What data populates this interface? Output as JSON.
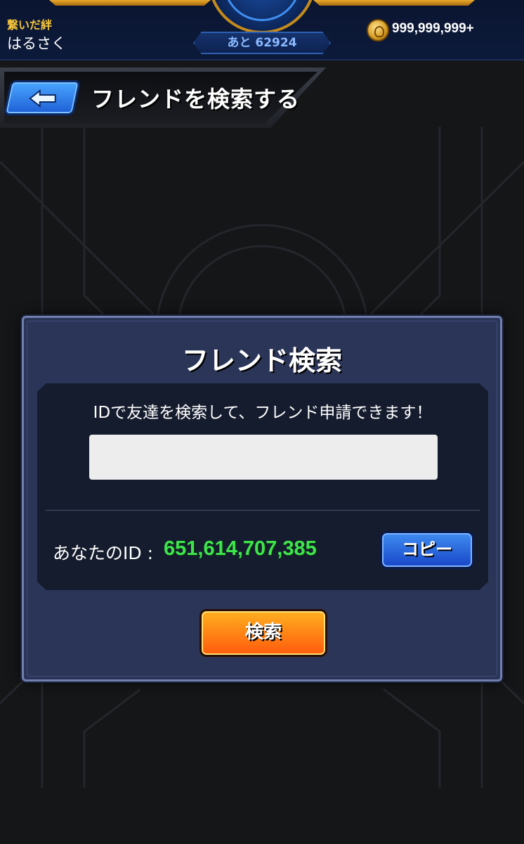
{
  "status_bar": {
    "bond_label": "繋いだ絆",
    "player_name": "はるさく",
    "remaining_prefix": "あと",
    "remaining_value": "62924",
    "coin_count": "999,999,999+"
  },
  "header": {
    "title": "フレンドを検索する"
  },
  "dialog": {
    "title": "フレンド検索",
    "instruction": "IDで友達を検索して、フレンド申請できます！",
    "input_value": "",
    "your_id_label": "あなたのID :",
    "your_id_value": "651,614,707,385",
    "copy_label": "コピー",
    "search_label": "検索"
  },
  "colors": {
    "accent_green": "#3fe44d",
    "copy_blue": "#1846c8",
    "search_orange": "#ff5a0c",
    "bond_gold": "#f2c23a"
  }
}
